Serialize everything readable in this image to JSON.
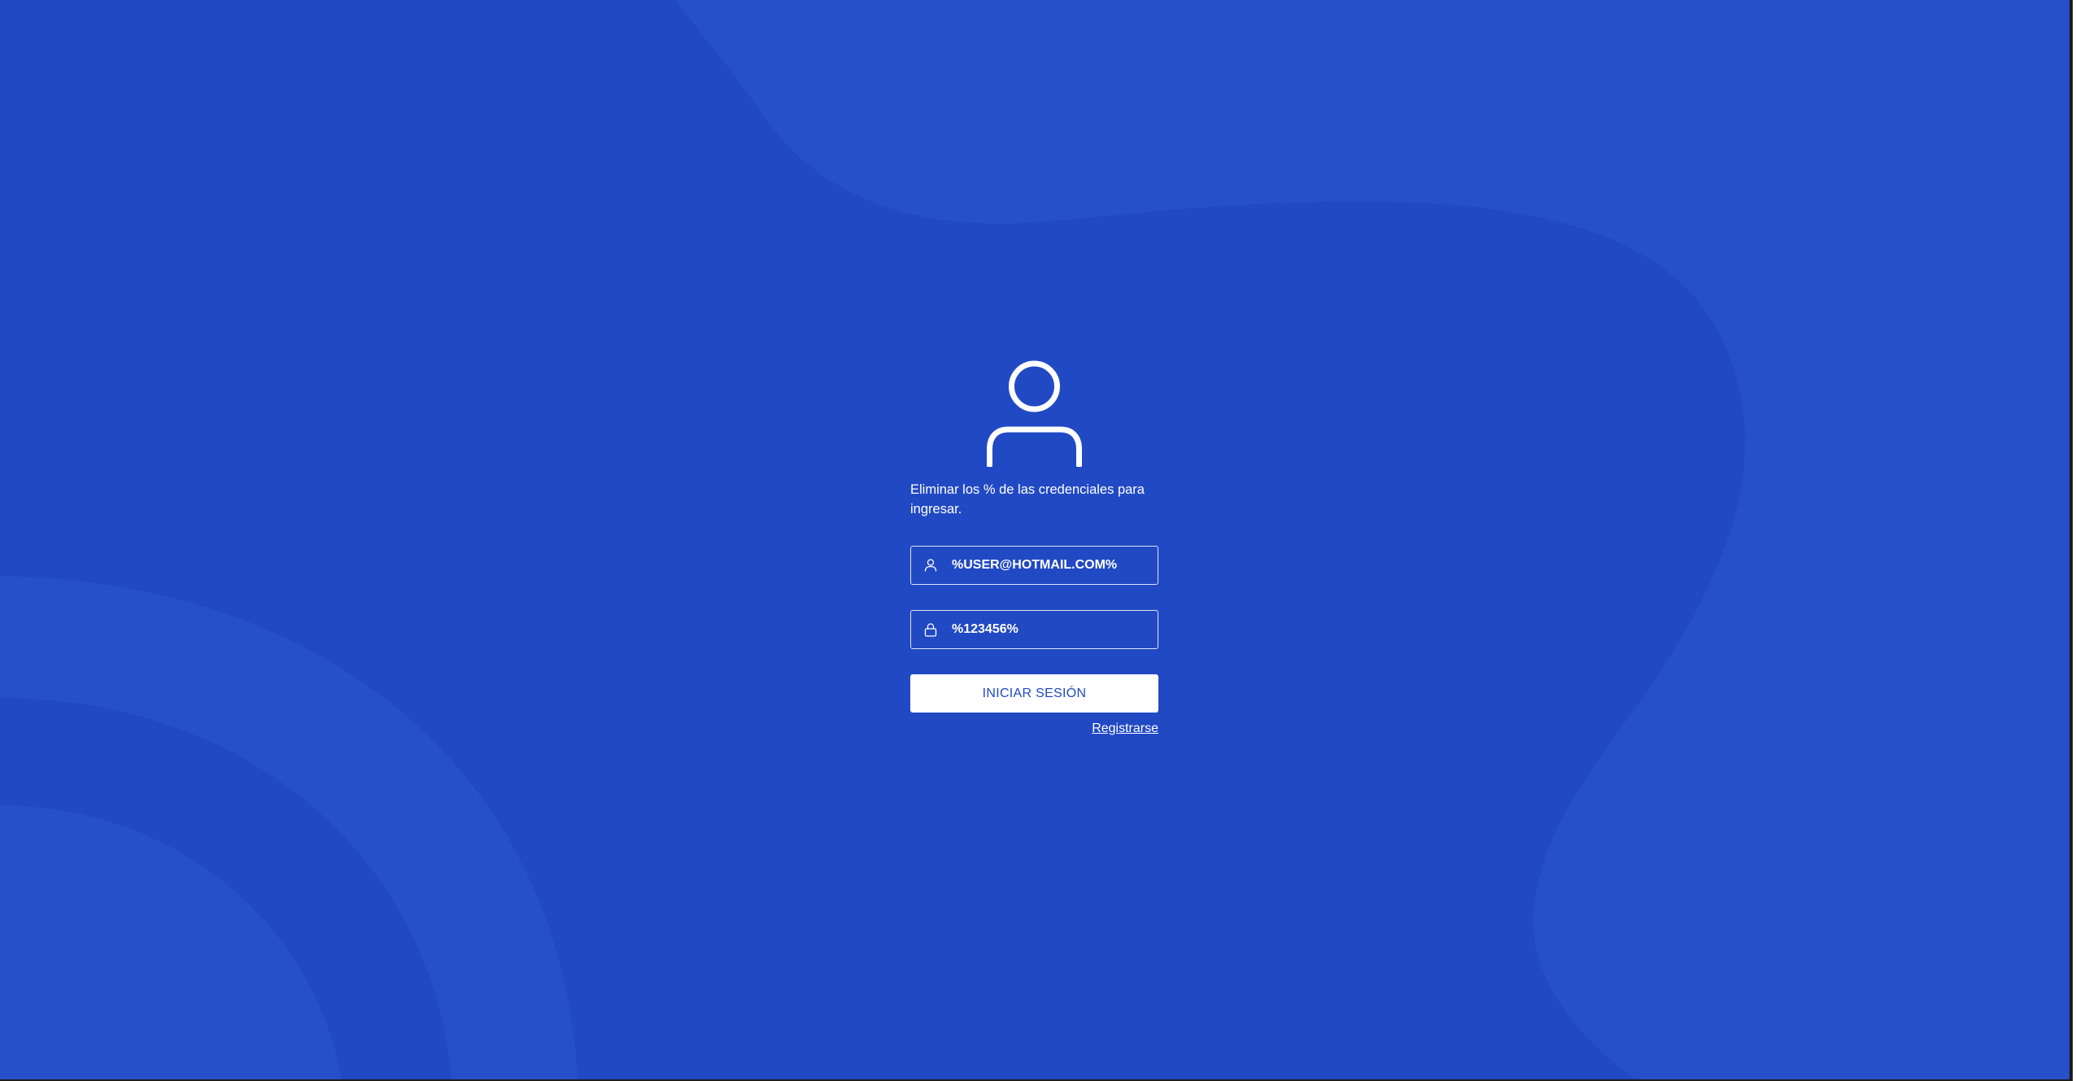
{
  "login": {
    "instructions": "Eliminar los % de las credenciales para ingresar.",
    "username_value": "%USER@HOTMAIL.COM%",
    "password_value": "%123456%",
    "submit_label": "INICIAR SESIÓN",
    "register_label": "Registrarse"
  },
  "icons": {
    "avatar": "user-avatar-icon",
    "username_field": "user-icon",
    "password_field": "lock-icon"
  },
  "colors": {
    "background": "#2149c3",
    "background_shape": "#264fca",
    "accent_text": "#2149c3",
    "foreground": "#ffffff"
  }
}
